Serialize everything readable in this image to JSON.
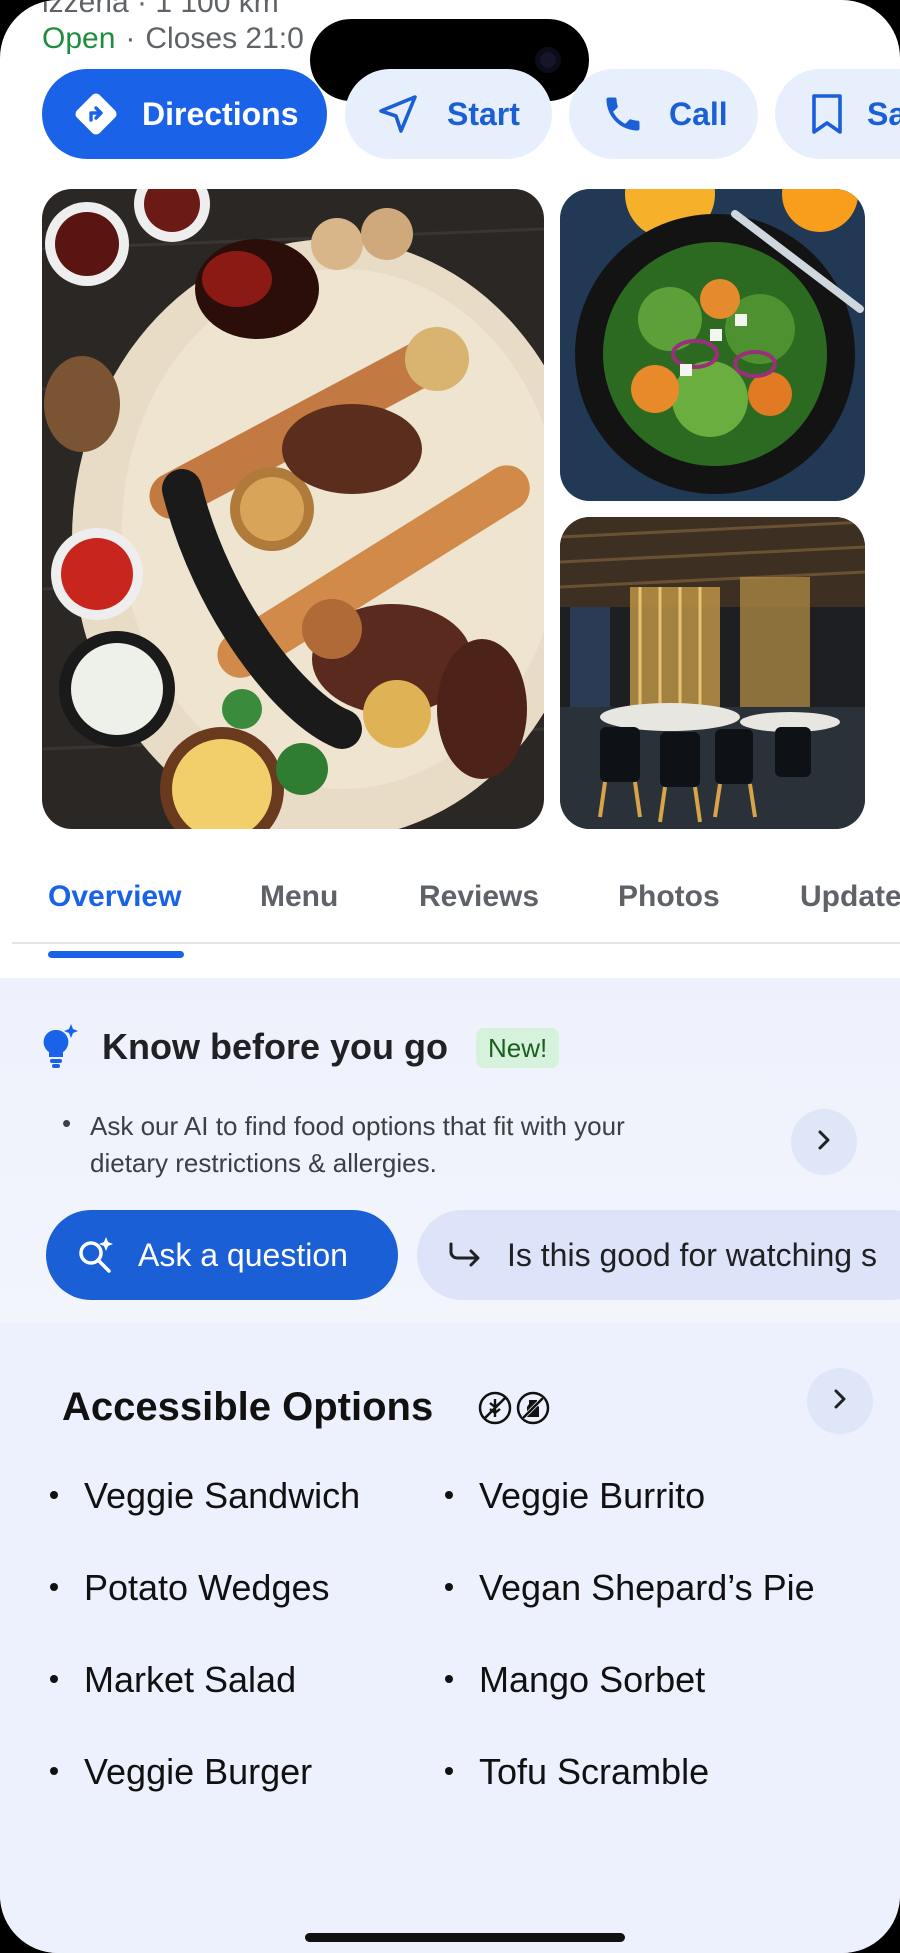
{
  "header": {
    "category_partial": "izzeria · 1 100 km",
    "status_open": "Open",
    "status_separator": "·",
    "status_closes": "Closes 21:0"
  },
  "actions": [
    {
      "label": "Directions",
      "icon": "directions-icon"
    },
    {
      "label": "Start",
      "icon": "navigation-arrow-icon"
    },
    {
      "label": "Call",
      "icon": "phone-icon"
    },
    {
      "label": "Sa",
      "icon": "bookmark-icon"
    }
  ],
  "photos": [
    {
      "name": "grilled-platter-photo"
    },
    {
      "name": "salad-photo"
    },
    {
      "name": "restaurant-interior-photo"
    }
  ],
  "tabs": [
    {
      "label": "Overview",
      "active": true
    },
    {
      "label": "Menu",
      "active": false
    },
    {
      "label": "Reviews",
      "active": false
    },
    {
      "label": "Photos",
      "active": false
    },
    {
      "label": "Update",
      "active": false
    }
  ],
  "know_before": {
    "title": "Know before you go",
    "badge": "New!",
    "bullet": "•",
    "text": "Ask our AI to find food options that fit with your dietary restrictions & allergies.",
    "ask_label": "Ask a question",
    "suggestion": "Is this good for watching s"
  },
  "accessible": {
    "title": "Accessible Options",
    "icons": [
      "no-gluten-icon",
      "no-dairy-icon"
    ],
    "items": [
      "Veggie Sandwich",
      "Veggie Burrito",
      "Potato Wedges",
      "Vegan Shepard’s Pie",
      "Market Salad",
      "Mango Sorbet",
      "Veggie Burger",
      "Tofu Scramble"
    ]
  },
  "colors": {
    "primary": "#1a63e8",
    "open_green": "#1e8e3e",
    "chip_bg": "#e8effc",
    "new_badge_bg": "#d7f2dc"
  }
}
